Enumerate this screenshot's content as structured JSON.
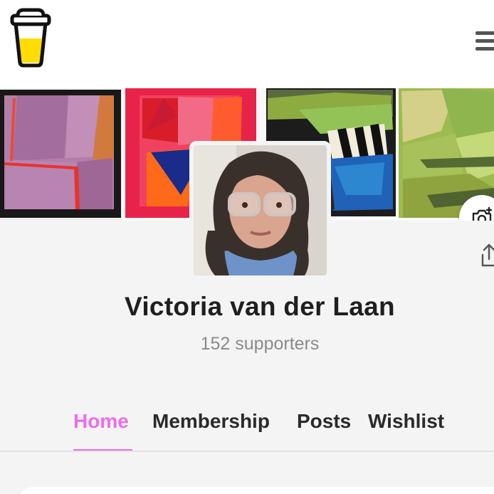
{
  "app": {
    "brand_colors": {
      "accent": "#ec6de8",
      "logo_fill": "#ffdd00"
    }
  },
  "header": {
    "logo_icon": "coffee-cup-logo",
    "menu_icon": "hamburger-menu-icon"
  },
  "cover": {
    "camera_icon": "camera-plus-icon"
  },
  "profile": {
    "name": "Victoria van der Laan",
    "supporters": "152 supporters",
    "share_icon": "share-icon"
  },
  "tabs": [
    {
      "label": "Home",
      "active": true
    },
    {
      "label": "Membership",
      "active": false
    },
    {
      "label": "Posts",
      "active": false
    },
    {
      "label": "Wishlist",
      "active": false
    }
  ]
}
